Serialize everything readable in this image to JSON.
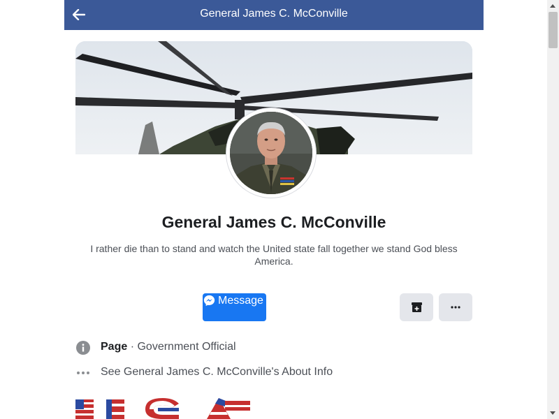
{
  "header": {
    "title": "General James C. McConville"
  },
  "profile": {
    "name": "General James C. McConville",
    "bio": "I rather die than to stand and watch the United state fall together we stand God bless America."
  },
  "actions": {
    "message_label": "Message"
  },
  "info": {
    "category_label": "Page",
    "category_separator": " · ",
    "category_value": "Government Official",
    "about_link": "See General James C. McConville's About Info"
  },
  "colors": {
    "header_bg": "#3b5998",
    "primary_button": "#1877f2",
    "secondary_button": "#e4e6eb"
  },
  "icons": {
    "back": "arrow-left-icon",
    "messenger": "messenger-icon",
    "bookmark": "bookmark-add-icon",
    "more": "more-dots-icon",
    "info": "info-icon",
    "about": "ellipsis-icon"
  }
}
